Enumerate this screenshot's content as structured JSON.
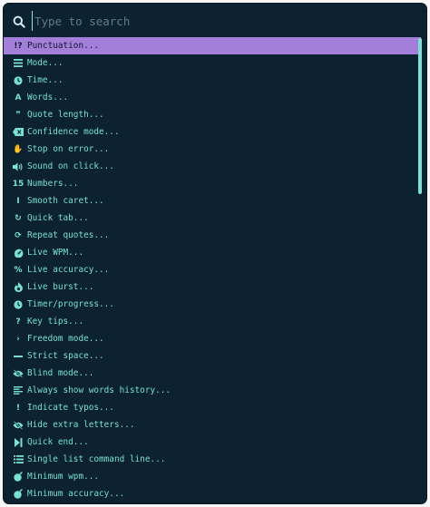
{
  "search": {
    "placeholder": "Type to search"
  },
  "colors": {
    "panel_bg": "#0c2230",
    "text": "#79e0d3",
    "selected_bg": "#a47fd9",
    "selected_text": "#131833",
    "scrollbar": "#79e0d3"
  },
  "commands": [
    {
      "label": "Punctuation...",
      "icon": "punctuation-icon",
      "glyph": "!?"
    },
    {
      "label": "Mode...",
      "icon": "bars-icon",
      "glyph": ""
    },
    {
      "label": "Time...",
      "icon": "clock-icon",
      "glyph": ""
    },
    {
      "label": "Words...",
      "icon": "letter-a-icon",
      "glyph": "A"
    },
    {
      "label": "Quote length...",
      "icon": "quote-icon",
      "glyph": "❞"
    },
    {
      "label": "Confidence mode...",
      "icon": "backspace-icon",
      "glyph": ""
    },
    {
      "label": "Stop on error...",
      "icon": "hand-icon",
      "glyph": "✋"
    },
    {
      "label": "Sound on click...",
      "icon": "volume-icon",
      "glyph": ""
    },
    {
      "label": "Numbers...",
      "icon": "numbers-icon",
      "glyph": "15"
    },
    {
      "label": "Smooth caret...",
      "icon": "text-cursor-icon",
      "glyph": "I"
    },
    {
      "label": "Quick tab...",
      "icon": "redo-icon",
      "glyph": "↻"
    },
    {
      "label": "Repeat quotes...",
      "icon": "sync-icon",
      "glyph": "⟳"
    },
    {
      "label": "Live WPM...",
      "icon": "gauge-icon",
      "glyph": ""
    },
    {
      "label": "Live accuracy...",
      "icon": "percent-icon",
      "glyph": "%"
    },
    {
      "label": "Live burst...",
      "icon": "fire-icon",
      "glyph": ""
    },
    {
      "label": "Timer/progress...",
      "icon": "clock-icon",
      "glyph": ""
    },
    {
      "label": "Key tips...",
      "icon": "question-icon",
      "glyph": "?"
    },
    {
      "label": "Freedom mode...",
      "icon": "chevron-right-icon",
      "glyph": "›"
    },
    {
      "label": "Strict space...",
      "icon": "minus-icon",
      "glyph": ""
    },
    {
      "label": "Blind mode...",
      "icon": "eye-slash-icon",
      "glyph": ""
    },
    {
      "label": "Always show words history...",
      "icon": "align-left-icon",
      "glyph": ""
    },
    {
      "label": "Indicate typos...",
      "icon": "exclamation-icon",
      "glyph": "!"
    },
    {
      "label": "Hide extra letters...",
      "icon": "eye-slash-icon",
      "glyph": ""
    },
    {
      "label": "Quick end...",
      "icon": "step-forward-icon",
      "glyph": ""
    },
    {
      "label": "Single list command line...",
      "icon": "list-icon",
      "glyph": ""
    },
    {
      "label": "Minimum wpm...",
      "icon": "bomb-icon",
      "glyph": ""
    },
    {
      "label": "Minimum accuracy...",
      "icon": "bomb-icon",
      "glyph": ""
    }
  ],
  "selected_index": 0,
  "scroll": {
    "position": 0.0,
    "visible_fraction": 0.33
  }
}
